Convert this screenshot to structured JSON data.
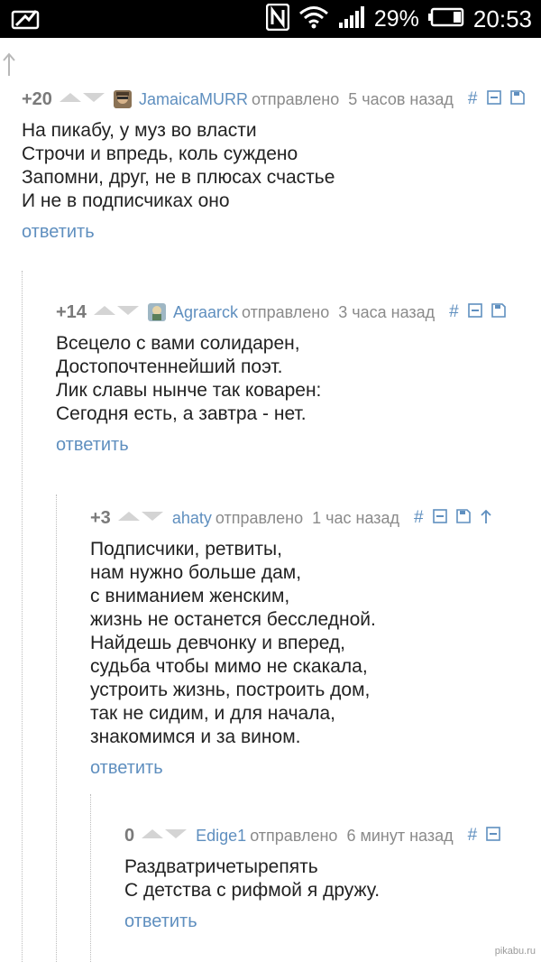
{
  "status_bar": {
    "battery_percent": "29%",
    "time": "20:53",
    "icons": [
      "notification-image-icon",
      "nfc-icon",
      "wifi-icon",
      "signal-icon",
      "battery-icon"
    ]
  },
  "colors": {
    "link": "#5f8fbf",
    "score": "#7a7a7a",
    "meta": "#8a8a8a",
    "text": "#222222"
  },
  "comments": [
    {
      "score": "+20",
      "author": "JamaicaMURR",
      "sent_label": "отправлено",
      "time": "5 часов назад",
      "hash": "#",
      "lines": [
        "На пикабу, у муз во власти",
        "Строчи и впредь, коль суждено",
        "Запомни, друг, не в плюсах счастье",
        "И не в подписчиках оно"
      ],
      "reply_label": "ответить"
    },
    {
      "score": "+14",
      "author": "Agraarck",
      "sent_label": "отправлено",
      "time": "3 часа назад",
      "hash": "#",
      "lines": [
        "Всецело с вами солидарен,",
        "Достопочтеннейший поэт.",
        "Лик славы нынче так коварен:",
        "Сегодня есть, а завтра - нет."
      ],
      "reply_label": "ответить"
    },
    {
      "score": "+3",
      "author": "ahaty",
      "sent_label": "отправлено",
      "time": "1 час назад",
      "hash": "#",
      "lines": [
        "Подписчики, ретвиты,",
        "нам нужно больше дам,",
        "с вниманием женским,",
        "жизнь не останется бесследной.",
        "Найдешь девчонку и вперед,",
        "судьба чтобы мимо не скакала,",
        "устроить жизнь, построить дом,",
        "так не сидим, и для начала,",
        "знакомимся и за вином."
      ],
      "reply_label": "ответить"
    },
    {
      "score": "0",
      "author": "Edige1",
      "sent_label": "отправлено",
      "time": "6 минут назад",
      "hash": "#",
      "lines": [
        "Раздватричетырепять",
        "С детства с рифмой я дружу."
      ],
      "reply_label": "ответить"
    }
  ],
  "watermark": "pikabu.ru"
}
